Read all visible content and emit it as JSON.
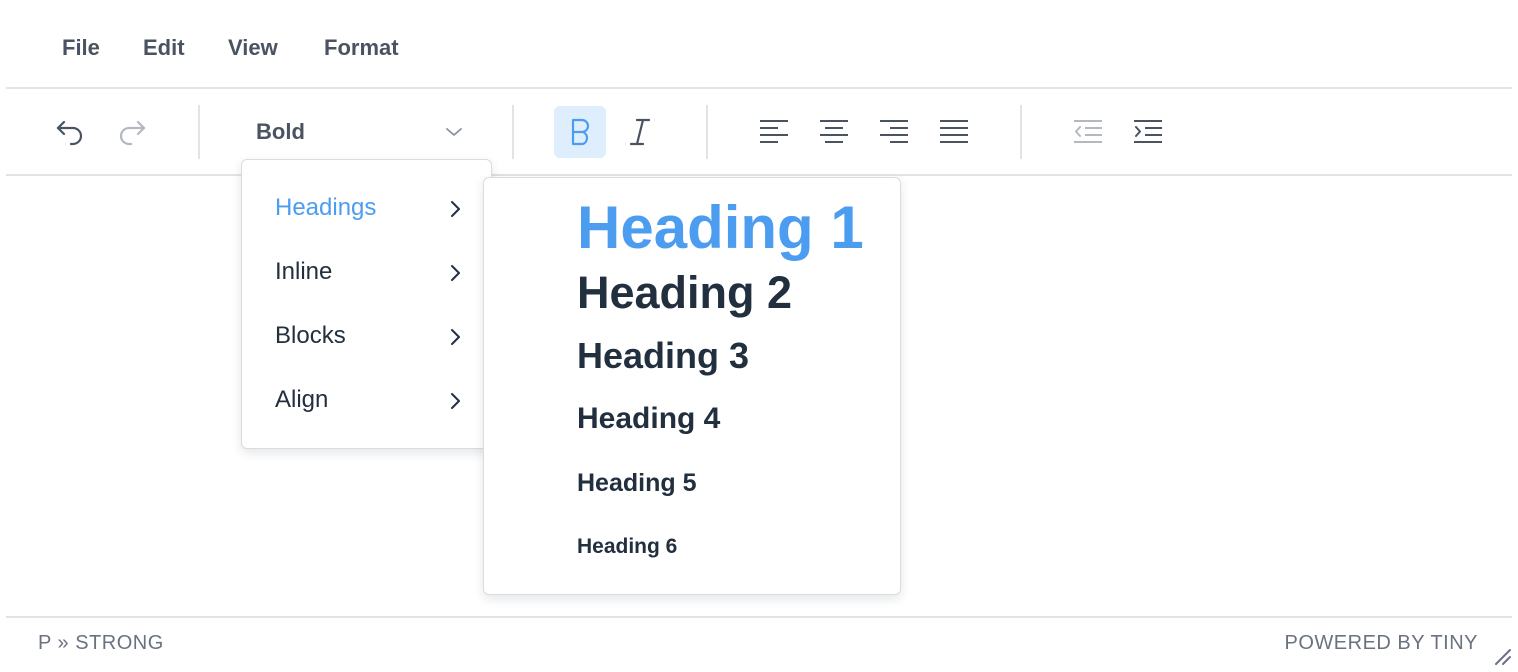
{
  "menubar": {
    "items": [
      {
        "label": "File"
      },
      {
        "label": "Edit"
      },
      {
        "label": "View"
      },
      {
        "label": "Format"
      }
    ]
  },
  "toolbar": {
    "undo_icon": "undo-icon",
    "redo_icon": "redo-icon",
    "formats_select": {
      "value": "Bold"
    },
    "bold_active": true,
    "accent_color": "#4c9df0"
  },
  "format_menu": {
    "items": [
      {
        "label": "Headings",
        "highlighted": true
      },
      {
        "label": "Inline"
      },
      {
        "label": "Blocks"
      },
      {
        "label": "Align"
      }
    ]
  },
  "headings_menu": {
    "items": [
      {
        "label": "Heading 1",
        "highlighted": true
      },
      {
        "label": "Heading 2"
      },
      {
        "label": "Heading 3"
      },
      {
        "label": "Heading 4"
      },
      {
        "label": "Heading 5"
      },
      {
        "label": "Heading 6"
      }
    ]
  },
  "statusbar": {
    "path": "P » STRONG",
    "branding": "POWERED BY TINY"
  }
}
